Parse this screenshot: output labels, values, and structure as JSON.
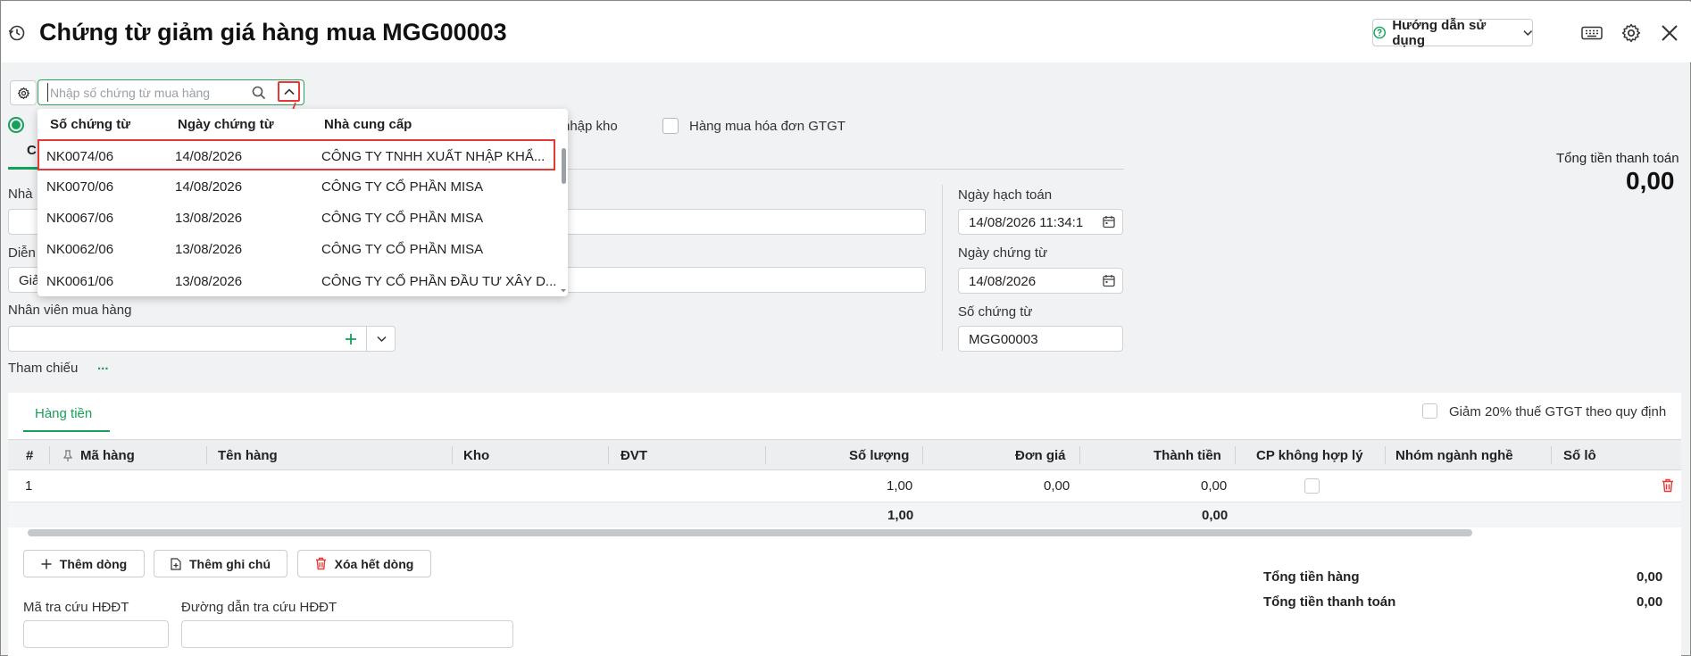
{
  "header": {
    "title": "Chứng từ giảm giá hàng mua MGG00003",
    "help_label": "Hướng dẫn sử dụng"
  },
  "search": {
    "placeholder": "Nhập số chứng từ mua hàng"
  },
  "options": {
    "opt_nhap_kho_partial": "nhập kho",
    "opt_hoa_don": "Hàng mua hóa đơn GTGT"
  },
  "tab_partial": "C",
  "dropdown": {
    "columns": [
      "Số chứng từ",
      "Ngày chứng từ",
      "Nhà cung cấp"
    ],
    "rows": [
      {
        "so": "NK0074/06",
        "ngay": "14/08/2026",
        "ncc": "CÔNG TY TNHH XUẤT NHẬP KHẨ..."
      },
      {
        "so": "NK0070/06",
        "ngay": "14/08/2026",
        "ncc": "CÔNG TY CỔ PHẦN MISA"
      },
      {
        "so": "NK0067/06",
        "ngay": "13/08/2026",
        "ncc": "CÔNG TY CỔ PHẦN MISA"
      },
      {
        "so": "NK0062/06",
        "ngay": "13/08/2026",
        "ncc": "CÔNG TY CỔ PHẦN MISA"
      },
      {
        "so": "NK0061/06",
        "ngay": "13/08/2026",
        "ncc": "CÔNG TY CỔ PHẦN ĐẦU TƯ XÂY D..."
      }
    ]
  },
  "form": {
    "nha_partial": "Nhà",
    "dien_partial": "Diễn",
    "dien_value_partial": "Giả",
    "nhan_vien_label": "Nhân viên mua hàng",
    "tham_chieu_label": "Tham chiếu",
    "tham_chieu_more": "...",
    "ngay_hach_toan_label": "Ngày hạch toán",
    "ngay_hach_toan_value": "14/08/2026 11:34:1",
    "ngay_chung_tu_label": "Ngày chứng từ",
    "ngay_chung_tu_value": "14/08/2026",
    "so_chung_tu_label": "Số chứng từ",
    "so_chung_tu_value": "MGG00003"
  },
  "totals_top": {
    "label": "Tổng tiền thanh toán",
    "value": "0,00"
  },
  "detail": {
    "tab_label": "Hàng tiền",
    "giam_thue_label": "Giảm 20% thuế GTGT theo quy định",
    "columns": [
      "#",
      "Mã hàng",
      "Tên hàng",
      "Kho",
      "ĐVT",
      "Số lượng",
      "Đơn giá",
      "Thành tiền",
      "CP không hợp lý",
      "Nhóm ngành nghề",
      "Số lô"
    ],
    "row": {
      "stt": "1",
      "so_luong": "1,00",
      "don_gia": "0,00",
      "thanh_tien": "0,00"
    },
    "sum": {
      "so_luong": "1,00",
      "thanh_tien": "0,00"
    },
    "btn_them_dong": "Thêm dòng",
    "btn_them_ghi_chu": "Thêm ghi chú",
    "btn_xoa_het": "Xóa hết dòng",
    "ma_tra_cuu_label": "Mã tra cứu HĐĐT",
    "duong_dan_label": "Đường dẫn tra cứu HĐĐT",
    "tong_tien_hang_label": "Tổng tiền hàng",
    "tong_tien_hang_value": "0,00",
    "tong_thanh_toan_label": "Tổng tiền thanh toán",
    "tong_thanh_toan_value": "0,00"
  },
  "colors": {
    "accent": "#16a05a",
    "highlight": "#e53935",
    "delete": "#e53935"
  }
}
